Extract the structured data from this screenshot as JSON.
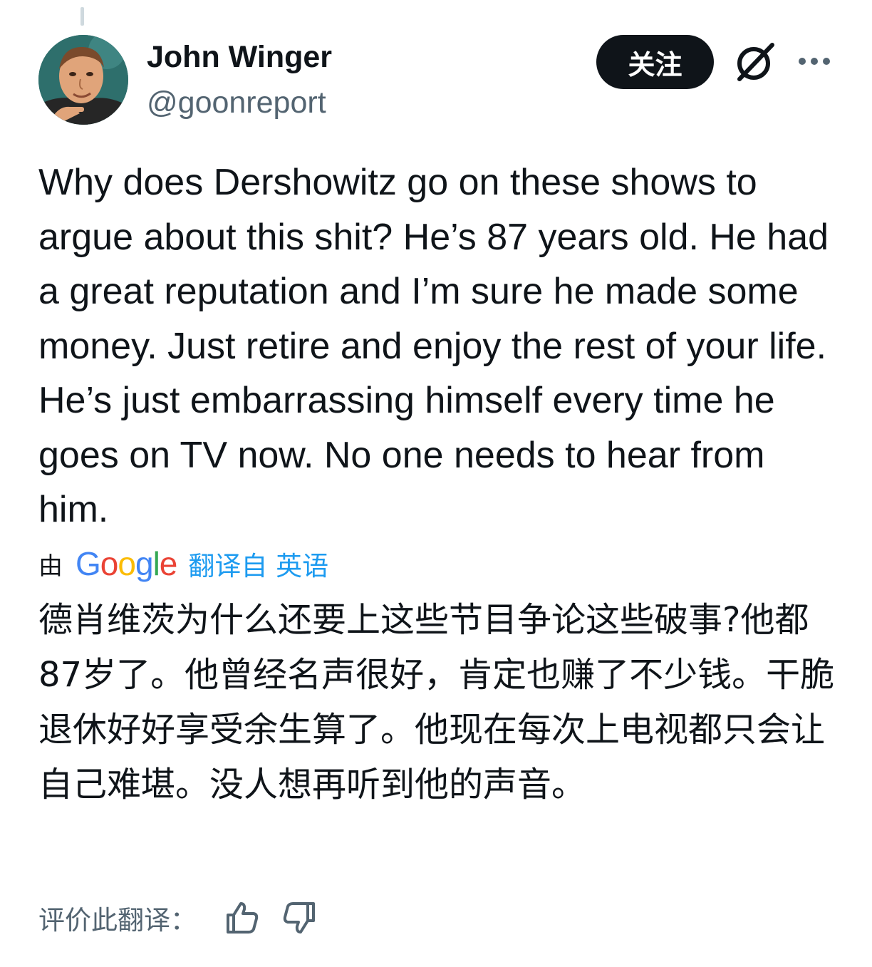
{
  "tweet": {
    "author": {
      "display_name": "John Winger",
      "handle": "@goonreport",
      "avatar_icon": "avatar-photo"
    },
    "follow_label": "关注",
    "text": "Why does Dershowitz go on these shows to argue about this shit? He’s 87 years old. He had a great reputation and I’m sure he made some money. Just retire and enjoy the rest of your life. He’s just embarrassing himself every time he goes on TV now. No one needs to hear from him."
  },
  "translation": {
    "by_label": "由",
    "provider": "Google",
    "link_label": "翻译自 英语",
    "text": "德肖维茨为什么还要上这些节目争论这些破事?他都87岁了。他曾经名声很好，肯定也赚了不少钱。干脆退休好好享受余生算了。他现在每次上电视都只会让自己难堪。没人想再听到他的声音。",
    "rate_label": "评价此翻译："
  },
  "icons": {
    "grok": "grok-icon",
    "more": "more-icon",
    "thumbs_up": "thumbs-up-icon",
    "thumbs_down": "thumbs-down-icon"
  },
  "colors": {
    "text": "#0f1419",
    "secondary": "#536471",
    "link": "#1d9bf0",
    "follow_button": "#0f1419"
  }
}
